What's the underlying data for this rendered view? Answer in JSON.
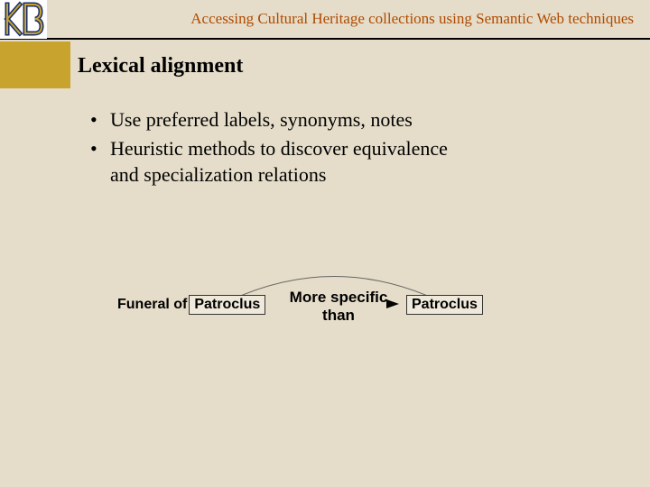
{
  "header": {
    "title": "Accessing Cultural Heritage collections using Semantic Web techniques",
    "logo_text": "KB"
  },
  "slide": {
    "title": "Lexical alignment",
    "bullets": [
      "Use preferred labels, synonyms, notes",
      "Heuristic methods to discover equivalence and specialization relations"
    ]
  },
  "diagram": {
    "left_prefix": "Funeral of",
    "left_term": "Patroclus",
    "relation": "More specific than",
    "right_term": "Patroclus"
  }
}
